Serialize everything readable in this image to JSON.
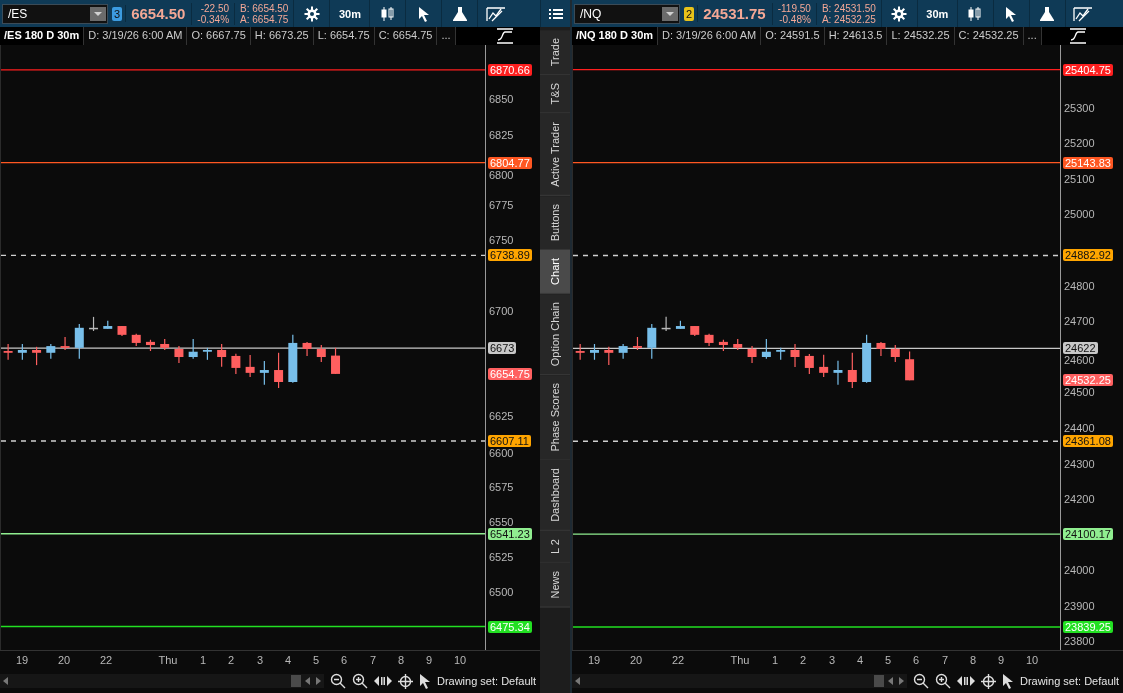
{
  "panels": [
    {
      "symbol": "/ES",
      "link": {
        "label": "3",
        "color": "#3c9be0"
      },
      "last": "6654.50",
      "change": "-22.50",
      "change_pct": "-0.34%",
      "bid": "B: 6654.50",
      "ask": "A: 6654.75",
      "timeframe": "30m",
      "study_title": "/ES 180 D 30m",
      "fields": [
        "D: 3/19/26 6:00 AM",
        "O: 6667.75",
        "H: 6673.25",
        "L: 6654.75",
        "C: 6654.75",
        "..."
      ],
      "chart_data": {
        "type": "candlestick",
        "categories": [
          null,
          null,
          null,
          null,
          null,
          null,
          null,
          null,
          null,
          null,
          null,
          null,
          null,
          null,
          null,
          null,
          null,
          null,
          null,
          null,
          null,
          null,
          null,
          null,
          null,
          null,
          null,
          null,
          null,
          null,
          null,
          null,
          null,
          null
        ],
        "ylim": [
          6458.66,
          6888.35
        ],
        "yticks": [
          6850,
          6825,
          6800,
          6775,
          6750,
          6700,
          6625,
          6600,
          6575,
          6550,
          6525,
          6500
        ],
        "ref_lines": [
          {
            "axis": "y",
            "value": 6870.66,
            "color": "#ff1f1f"
          },
          {
            "axis": "y",
            "value": 6804.77,
            "color": "#ff5722"
          },
          {
            "axis": "y",
            "value": 6738.89,
            "color": "#d0d0d0"
          },
          {
            "axis": "y",
            "value": 6673,
            "color": "#c8c8c8"
          },
          {
            "axis": "y",
            "value": 6607.11,
            "color": "#d0d0d0"
          },
          {
            "axis": "y",
            "value": 6541.23,
            "color": "#90ee90"
          },
          {
            "axis": "y",
            "value": 6475.34,
            "color": "#22e022"
          }
        ],
        "ohlc": [
          [
            6671,
            6676,
            6664.75,
            6669.75
          ],
          [
            6669.75,
            6676,
            6664.75,
            6671.75
          ],
          [
            6671.75,
            6674,
            6661,
            6669.75
          ],
          [
            6669.75,
            6676,
            6665.5,
            6674.5
          ],
          [
            6674.5,
            6681,
            6671.75,
            6673.25
          ],
          [
            6673.25,
            6690.25,
            6665.5,
            6687.5
          ],
          [
            6687.5,
            6695.25,
            6685.25,
            6687.5
          ],
          [
            6686.75,
            6692.5,
            6686.75,
            6688.75
          ],
          [
            6688.75,
            6688.75,
            6681.75,
            6682.5
          ],
          [
            6682.5,
            6683.25,
            6674.5,
            6676.75
          ],
          [
            6677.5,
            6679,
            6671,
            6675.25
          ],
          [
            6676,
            6679.5,
            6671.75,
            6673.25
          ],
          [
            6672.5,
            6674.5,
            6662.5,
            6666.75
          ],
          [
            6666.75,
            6679.5,
            6665.5,
            6670.5
          ],
          [
            6670.5,
            6673.25,
            6664.75,
            6671.75
          ],
          [
            6671.75,
            6676,
            6659.75,
            6666.75
          ],
          [
            6667.5,
            6669,
            6654.75,
            6659
          ],
          [
            6659.75,
            6668.25,
            6652.5,
            6655.5
          ],
          [
            6655.5,
            6664,
            6647,
            6657.5
          ],
          [
            6657.5,
            6669.75,
            6644.75,
            6649
          ],
          [
            6649,
            6682.5,
            6648.5,
            6676.75
          ],
          [
            6676.75,
            6677.5,
            6667.5,
            6672.5
          ],
          [
            6672.5,
            6675.25,
            6663.25,
            6666.75
          ],
          [
            6667.75,
            6673.25,
            6654.75,
            6654.75
          ],
          null,
          null,
          null,
          null,
          null,
          null,
          null,
          null,
          null,
          null
        ]
      },
      "price_labels": [
        {
          "label": "6870.66",
          "color": "#ff1f1f",
          "kind": "solid"
        },
        {
          "label": "6804.77",
          "color": "#ff5722",
          "kind": "solid"
        },
        {
          "label": "6738.89",
          "color": "#ffa500",
          "kind": "dashed"
        },
        {
          "label": "6673",
          "color": "#c8c8c8",
          "kind": "solid"
        },
        {
          "label": "6654.75",
          "color": "#ff6060"
        },
        {
          "label": "6607.11",
          "color": "#ffa500",
          "kind": "dashed"
        },
        {
          "label": "6541.23",
          "color": "#90ee90",
          "kind": "solid"
        },
        {
          "label": "6475.34",
          "color": "#22e022",
          "kind": "solid"
        }
      ],
      "time_labels": [
        "19",
        "20",
        "22",
        "Thu",
        "1",
        "2",
        "3",
        "4",
        "5",
        "6",
        "7",
        "8",
        "9",
        "10"
      ],
      "drawing_set": "Drawing set: Default",
      "side_tabs": [
        {
          "label": "Trade",
          "selected": false
        },
        {
          "label": "T&S",
          "selected": false
        },
        {
          "label": "Active Trader",
          "selected": false
        },
        {
          "label": "Buttons",
          "selected": false
        },
        {
          "label": "Chart",
          "selected": true
        },
        {
          "label": "Option Chain",
          "selected": false
        },
        {
          "label": "Phase Scores",
          "selected": false
        },
        {
          "label": "Dashboard",
          "selected": false
        },
        {
          "label": "L 2",
          "selected": false
        },
        {
          "label": "News",
          "selected": false
        }
      ]
    },
    {
      "symbol": "/NQ",
      "link": {
        "label": "2",
        "color": "#e8c31a"
      },
      "last": "24531.75",
      "change": "-119.50",
      "change_pct": "-0.48%",
      "bid": "B: 24531.50",
      "ask": "A: 24532.25",
      "timeframe": "30m",
      "study_title": "/NQ 180 D 30m",
      "fields": [
        "D: 3/19/26 6:00 AM",
        "O: 24591.5",
        "H: 24613.5",
        "L: 24532.25",
        "C: 24532.25",
        "..."
      ],
      "chart_data": {
        "type": "candlestick",
        "categories": [
          null,
          null,
          null,
          null,
          null,
          null,
          null,
          null,
          null,
          null,
          null,
          null,
          null,
          null,
          null,
          null,
          null,
          null,
          null,
          null,
          null,
          null,
          null,
          null,
          null,
          null,
          null,
          null,
          null,
          null,
          null,
          null,
          null,
          null
        ],
        "ylim": [
          23774.7,
          25474.2
        ],
        "yticks": [
          25300,
          25200,
          25100,
          25000,
          24800,
          24700,
          24600,
          24500,
          24400,
          24300,
          24200,
          24000,
          23900,
          23800
        ],
        "ref_lines": [
          {
            "axis": "y",
            "value": 25404.75,
            "color": "#ff1f1f"
          },
          {
            "axis": "y",
            "value": 25143.83,
            "color": "#ff5722"
          },
          {
            "axis": "y",
            "value": 24882.92,
            "color": "#d0d0d0"
          },
          {
            "axis": "y",
            "value": 24622,
            "color": "#c8c8c8"
          },
          {
            "axis": "y",
            "value": 24361.08,
            "color": "#d0d0d0"
          },
          {
            "axis": "y",
            "value": 24100.17,
            "color": "#90ee90"
          },
          {
            "axis": "y",
            "value": 23839.25,
            "color": "#22e022"
          }
        ],
        "ohlc": [
          [
            24614.5,
            24634.25,
            24590,
            24609.5
          ],
          [
            24609.5,
            24634.25,
            24590,
            24617.5
          ],
          [
            24617.5,
            24626.5,
            24575,
            24609.5
          ],
          [
            24609.5,
            24634.25,
            24592.75,
            24628.5
          ],
          [
            24628.5,
            24654,
            24617.5,
            24623.5
          ],
          [
            24623.5,
            24690.75,
            24592.75,
            24679.75
          ],
          [
            24679.75,
            24710.5,
            24671,
            24679.75
          ],
          [
            24676.75,
            24699.5,
            24676.75,
            24684.75
          ],
          [
            24684.75,
            24684.75,
            24657,
            24660
          ],
          [
            24660,
            24663,
            24628.5,
            24637.25
          ],
          [
            24640.25,
            24646.25,
            24614.5,
            24631.5
          ],
          [
            24634.25,
            24648.25,
            24617.5,
            24623.5
          ],
          [
            24620.5,
            24628.5,
            24581,
            24597.75
          ],
          [
            24597.75,
            24648.25,
            24592.75,
            24612.5
          ],
          [
            24612.5,
            24623.5,
            24590,
            24617.5
          ],
          [
            24617.5,
            24634.25,
            24570,
            24597.75
          ],
          [
            24600.75,
            24606.5,
            24550.25,
            24567
          ],
          [
            24570,
            24603.75,
            24541.5,
            24553.25
          ],
          [
            24553.25,
            24587,
            24519.5,
            24561.25
          ],
          [
            24561.25,
            24609.5,
            24510.75,
            24527.5
          ],
          [
            24527.5,
            24660,
            24525.5,
            24637.25
          ],
          [
            24637.25,
            24640.25,
            24600.75,
            24620.5
          ],
          [
            24620.5,
            24631.5,
            24584,
            24597.75
          ],
          [
            24591.5,
            24613.5,
            24532.25,
            24532.25
          ],
          null,
          null,
          null,
          null,
          null,
          null,
          null,
          null,
          null,
          null
        ]
      },
      "price_labels": [
        {
          "label": "25404.75",
          "color": "#ff1f1f",
          "kind": "solid"
        },
        {
          "label": "25143.83",
          "color": "#ff5722",
          "kind": "solid"
        },
        {
          "label": "24882.92",
          "color": "#ffa500",
          "kind": "dashed"
        },
        {
          "label": "24622",
          "color": "#c8c8c8",
          "kind": "solid"
        },
        {
          "label": "24532.25",
          "color": "#ff6060"
        },
        {
          "label": "24361.08",
          "color": "#ffa500",
          "kind": "dashed"
        },
        {
          "label": "24100.17",
          "color": "#90ee90",
          "kind": "solid"
        },
        {
          "label": "23839.25",
          "color": "#22e022",
          "kind": "solid"
        }
      ],
      "time_labels": [
        "19",
        "20",
        "22",
        "Thu",
        "1",
        "2",
        "3",
        "4",
        "5",
        "6",
        "7",
        "8",
        "9",
        "10"
      ],
      "drawing_set": "Drawing set: Default"
    }
  ]
}
